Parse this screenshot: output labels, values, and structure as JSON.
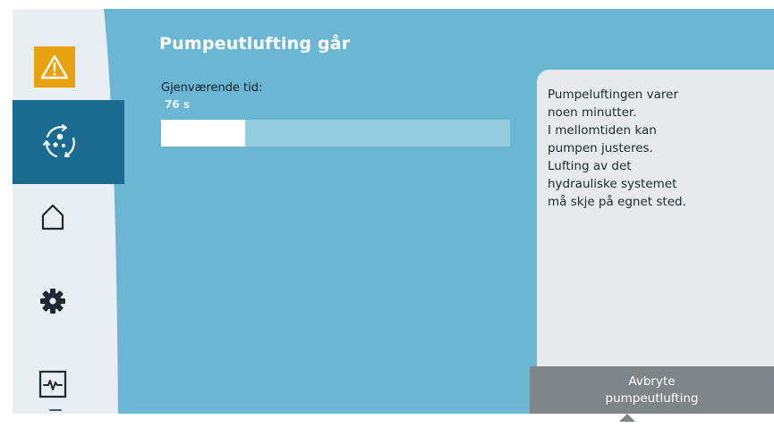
{
  "screen": {
    "title": "Pumpeutlufting går",
    "remaining_label": "Gjenværende tid:",
    "remaining_value": "76 s",
    "progress_fraction": 0.24
  },
  "info": {
    "text": "Pumpeluftingen varer\nnoen minutter.\nI mellomtiden kan\npumpen justeres.\nLufting av det\nhydrauliske systemet\nmå skje på egnet sted."
  },
  "actions": {
    "cancel_label": "Avbryte\npumpeutlufting"
  },
  "sidebar": {
    "items": [
      {
        "icon": "warning-icon",
        "active": false
      },
      {
        "icon": "venting-icon",
        "active": true
      },
      {
        "icon": "home-icon",
        "active": false
      },
      {
        "icon": "settings-icon",
        "active": false
      },
      {
        "icon": "diagnostics-icon",
        "active": false
      }
    ]
  },
  "colors": {
    "background": "#6bb6d2",
    "sidebar": "#e8eef1",
    "active_nav": "#1b6a8f",
    "warning": "#e8a10f",
    "panel": "#e6eaec",
    "button": "#7e8589"
  }
}
